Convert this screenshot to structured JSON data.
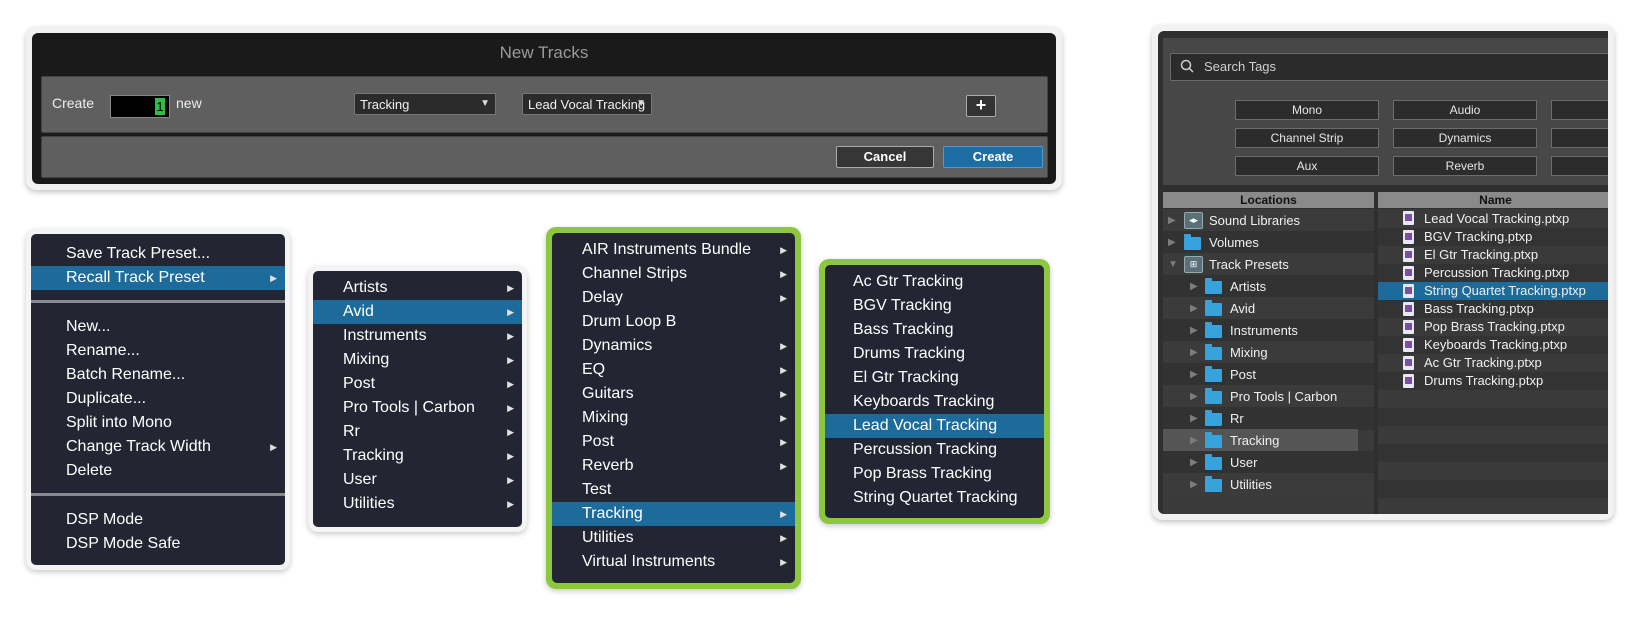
{
  "new_tracks": {
    "title": "New Tracks",
    "create_label": "Create",
    "count": "1",
    "new_label": "new",
    "category": "Tracking",
    "preset": "Lead Vocal Tracking",
    "add_symbol": "+",
    "cancel": "Cancel",
    "create": "Create"
  },
  "track_menu": {
    "items": [
      {
        "label": "Save Track Preset..."
      },
      {
        "label": "Recall Track Preset",
        "submenu": true,
        "highlighted": true
      },
      {
        "label": "New..."
      },
      {
        "label": "Rename..."
      },
      {
        "label": "Batch Rename..."
      },
      {
        "label": "Duplicate..."
      },
      {
        "label": "Split into Mono"
      },
      {
        "label": "Change Track Width",
        "submenu": true
      },
      {
        "label": "Delete"
      },
      {
        "label": "DSP Mode"
      },
      {
        "label": "DSP Mode Safe"
      }
    ]
  },
  "preset_categories": {
    "items": [
      "Artists",
      "Avid",
      "Instruments",
      "Mixing",
      "Post",
      "Pro Tools | Carbon",
      "Rr",
      "Tracking",
      "User",
      "Utilities"
    ],
    "highlighted": "Avid"
  },
  "avid_menu": {
    "items": [
      "AIR Instruments Bundle",
      "Channel Strips",
      "Delay",
      "Drum Loop B",
      "Dynamics",
      "EQ",
      "Guitars",
      "Mixing",
      "Post",
      "Reverb",
      "Test",
      "Tracking",
      "Utilities",
      "Virtual Instruments"
    ],
    "highlighted": "Tracking"
  },
  "tracking_menu": {
    "items": [
      "Ac Gtr Tracking",
      "BGV Tracking",
      "Bass Tracking",
      "Drums Tracking",
      "El Gtr Tracking",
      "Keyboards Tracking",
      "Lead Vocal Tracking",
      "Percussion Tracking",
      "Pop Brass Tracking",
      "String Quartet Tracking"
    ],
    "highlighted": "Lead Vocal Tracking"
  },
  "browser": {
    "search_placeholder": "Search Tags",
    "tags": [
      "Mono",
      "Audio",
      "Channel Strip",
      "Dynamics",
      "Aux",
      "Reverb"
    ],
    "locations_header": "Locations",
    "name_header": "Name",
    "locations": [
      {
        "label": "Sound Libraries",
        "icon": "sound-library-icon"
      },
      {
        "label": "Volumes",
        "icon": "folder-icon"
      },
      {
        "label": "Track Presets",
        "icon": "track-presets-icon",
        "expanded": true
      },
      {
        "label": "Artists",
        "icon": "folder-icon"
      },
      {
        "label": "Avid",
        "icon": "folder-icon"
      },
      {
        "label": "Instruments",
        "icon": "folder-icon"
      },
      {
        "label": "Mixing",
        "icon": "folder-icon"
      },
      {
        "label": "Post",
        "icon": "folder-icon"
      },
      {
        "label": "Pro Tools | Carbon",
        "icon": "folder-icon"
      },
      {
        "label": "Rr",
        "icon": "folder-icon"
      },
      {
        "label": "Tracking",
        "icon": "folder-icon",
        "selected": true
      },
      {
        "label": "User",
        "icon": "folder-icon"
      },
      {
        "label": "Utilities",
        "icon": "folder-icon"
      }
    ],
    "files": [
      "Lead Vocal Tracking.ptxp",
      "BGV Tracking.ptxp",
      "El Gtr Tracking.ptxp",
      "Percussion Tracking.ptxp",
      "String Quartet Tracking.ptxp",
      "Bass Tracking.ptxp",
      "Pop Brass Tracking.ptxp",
      "Keyboards Tracking.ptxp",
      "Ac Gtr Tracking.ptxp",
      "Drums Tracking.ptxp"
    ],
    "selected_file": "String Quartet Tracking.ptxp"
  },
  "colors": {
    "menu_bg": "#232632",
    "highlight": "#1d6b9a",
    "accent_green": "#8dc63f",
    "folder_blue": "#37a3dc"
  }
}
